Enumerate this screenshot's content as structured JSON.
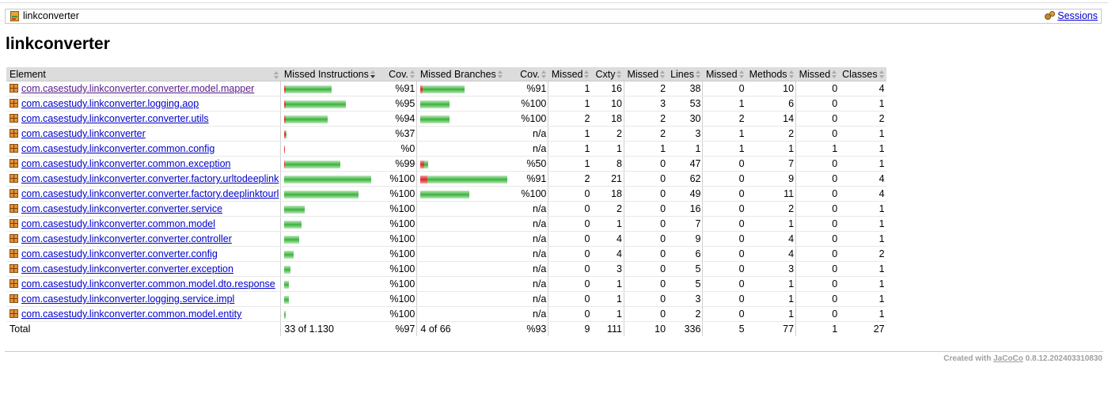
{
  "breadcrumb": {
    "title": "linkconverter",
    "sessions_label": "Sessions"
  },
  "page_title": "linkconverter",
  "headers": [
    "Element",
    "Missed Instructions",
    "Cov.",
    "Missed Branches",
    "Cov.",
    "Missed",
    "Cxty",
    "Missed",
    "Lines",
    "Missed",
    "Methods",
    "Missed",
    "Classes"
  ],
  "rows": [
    {
      "name": "com.casestudy.linkconverter.converter.model.mapper",
      "ins_cov": "%91",
      "ins_missed": 0.02,
      "ins_covered": 0.53,
      "br_cov": "%91",
      "br_missed": 0.03,
      "br_covered": 0.48,
      "mcx": "1",
      "cx": "16",
      "ml": "2",
      "l": "38",
      "mm": "0",
      "m": "10",
      "mc": "0",
      "c": "4",
      "visited": true
    },
    {
      "name": "com.casestudy.linkconverter.logging.aop",
      "ins_cov": "%95",
      "ins_missed": 0.02,
      "ins_covered": 0.69,
      "br_cov": "%100",
      "br_missed": 0,
      "br_covered": 0.34,
      "mcx": "1",
      "cx": "10",
      "ml": "3",
      "l": "53",
      "mm": "1",
      "m": "6",
      "mc": "0",
      "c": "1"
    },
    {
      "name": "com.casestudy.linkconverter.converter.utils",
      "ins_cov": "%94",
      "ins_missed": 0.02,
      "ins_covered": 0.48,
      "br_cov": "%100",
      "br_missed": 0,
      "br_covered": 0.34,
      "mcx": "2",
      "cx": "18",
      "ml": "2",
      "l": "30",
      "mm": "2",
      "m": "14",
      "mc": "0",
      "c": "2"
    },
    {
      "name": "com.casestudy.linkconverter",
      "ins_cov": "%37",
      "ins_missed": 0.02,
      "ins_covered": 0.01,
      "br_cov": "n/a",
      "br_missed": 0,
      "br_covered": 0,
      "mcx": "1",
      "cx": "2",
      "ml": "2",
      "l": "3",
      "mm": "1",
      "m": "2",
      "mc": "0",
      "c": "1"
    },
    {
      "name": "com.casestudy.linkconverter.common.config",
      "ins_cov": "%0",
      "ins_missed": 0.01,
      "ins_covered": 0,
      "br_cov": "n/a",
      "br_missed": 0,
      "br_covered": 0,
      "mcx": "1",
      "cx": "1",
      "ml": "1",
      "l": "1",
      "mm": "1",
      "m": "1",
      "mc": "1",
      "c": "1"
    },
    {
      "name": "com.casestudy.linkconverter.common.exception",
      "ins_cov": "%99",
      "ins_missed": 0.005,
      "ins_covered": 0.64,
      "br_cov": "%50",
      "br_missed": 0.045,
      "br_covered": 0.045,
      "mcx": "1",
      "cx": "8",
      "ml": "0",
      "l": "47",
      "mm": "0",
      "m": "7",
      "mc": "0",
      "c": "1"
    },
    {
      "name": "com.casestudy.linkconverter.converter.factory.urltodeeplink",
      "ins_cov": "%100",
      "ins_missed": 0,
      "ins_covered": 1.0,
      "br_cov": "%91",
      "br_missed": 0.08,
      "br_covered": 0.92,
      "mcx": "2",
      "cx": "21",
      "ml": "0",
      "l": "62",
      "mm": "0",
      "m": "9",
      "mc": "0",
      "c": "4"
    },
    {
      "name": "com.casestudy.linkconverter.converter.factory.deeplinktourl",
      "ins_cov": "%100",
      "ins_missed": 0,
      "ins_covered": 0.85,
      "br_cov": "%100",
      "br_missed": 0,
      "br_covered": 0.56,
      "mcx": "0",
      "cx": "18",
      "ml": "0",
      "l": "49",
      "mm": "0",
      "m": "11",
      "mc": "0",
      "c": "4"
    },
    {
      "name": "com.casestudy.linkconverter.converter.service",
      "ins_cov": "%100",
      "ins_missed": 0,
      "ins_covered": 0.24,
      "br_cov": "n/a",
      "br_missed": 0,
      "br_covered": 0,
      "mcx": "0",
      "cx": "2",
      "ml": "0",
      "l": "16",
      "mm": "0",
      "m": "2",
      "mc": "0",
      "c": "1"
    },
    {
      "name": "com.casestudy.linkconverter.common.model",
      "ins_cov": "%100",
      "ins_missed": 0,
      "ins_covered": 0.2,
      "br_cov": "n/a",
      "br_missed": 0,
      "br_covered": 0,
      "mcx": "0",
      "cx": "1",
      "ml": "0",
      "l": "7",
      "mm": "0",
      "m": "1",
      "mc": "0",
      "c": "1"
    },
    {
      "name": "com.casestudy.linkconverter.converter.controller",
      "ins_cov": "%100",
      "ins_missed": 0,
      "ins_covered": 0.17,
      "br_cov": "n/a",
      "br_missed": 0,
      "br_covered": 0,
      "mcx": "0",
      "cx": "4",
      "ml": "0",
      "l": "9",
      "mm": "0",
      "m": "4",
      "mc": "0",
      "c": "1"
    },
    {
      "name": "com.casestudy.linkconverter.converter.config",
      "ins_cov": "%100",
      "ins_missed": 0,
      "ins_covered": 0.11,
      "br_cov": "n/a",
      "br_missed": 0,
      "br_covered": 0,
      "mcx": "0",
      "cx": "4",
      "ml": "0",
      "l": "6",
      "mm": "0",
      "m": "4",
      "mc": "0",
      "c": "2"
    },
    {
      "name": "com.casestudy.linkconverter.converter.exception",
      "ins_cov": "%100",
      "ins_missed": 0,
      "ins_covered": 0.07,
      "br_cov": "n/a",
      "br_missed": 0,
      "br_covered": 0,
      "mcx": "0",
      "cx": "3",
      "ml": "0",
      "l": "5",
      "mm": "0",
      "m": "3",
      "mc": "0",
      "c": "1"
    },
    {
      "name": "com.casestudy.linkconverter.common.model.dto.response",
      "ins_cov": "%100",
      "ins_missed": 0,
      "ins_covered": 0.05,
      "br_cov": "n/a",
      "br_missed": 0,
      "br_covered": 0,
      "mcx": "0",
      "cx": "1",
      "ml": "0",
      "l": "5",
      "mm": "0",
      "m": "1",
      "mc": "0",
      "c": "1"
    },
    {
      "name": "com.casestudy.linkconverter.logging.service.impl",
      "ins_cov": "%100",
      "ins_missed": 0,
      "ins_covered": 0.05,
      "br_cov": "n/a",
      "br_missed": 0,
      "br_covered": 0,
      "mcx": "0",
      "cx": "1",
      "ml": "0",
      "l": "3",
      "mm": "0",
      "m": "1",
      "mc": "0",
      "c": "1"
    },
    {
      "name": "com.casestudy.linkconverter.common.model.entity",
      "ins_cov": "%100",
      "ins_missed": 0,
      "ins_covered": 0.015,
      "br_cov": "n/a",
      "br_missed": 0,
      "br_covered": 0,
      "mcx": "0",
      "cx": "1",
      "ml": "0",
      "l": "2",
      "mm": "0",
      "m": "1",
      "mc": "0",
      "c": "1"
    }
  ],
  "total": {
    "label": "Total",
    "ins": "33 of 1.130",
    "ins_cov": "%97",
    "br": "4 of 66",
    "br_cov": "%93",
    "mcx": "9",
    "cx": "111",
    "ml": "10",
    "l": "336",
    "mm": "5",
    "m": "77",
    "mc": "1",
    "c": "27"
  },
  "footer": {
    "prefix": "Created with",
    "link": "JaCoCo",
    "version": "0.8.12.202403310830"
  },
  "colors": {
    "missed_bar": "#d82828",
    "covered_bar": "#3bb33b",
    "header_bg": "#dcdcdc",
    "link": "#0000cc",
    "visited_link": "#551a8b"
  }
}
